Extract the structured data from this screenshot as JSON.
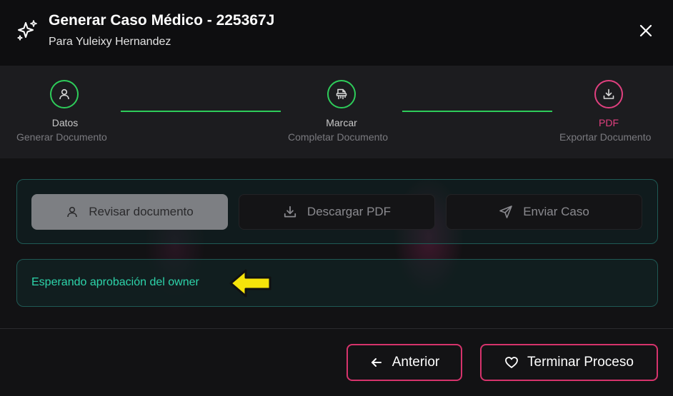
{
  "header": {
    "title": "Generar Caso Médico - 225367J",
    "subtitle": "Para Yuleixy Hernandez"
  },
  "stepper": {
    "steps": [
      {
        "label": "Datos",
        "sublabel": "Generar Documento",
        "icon": "user-icon",
        "state": "completed"
      },
      {
        "label": "Marcar",
        "sublabel": "Completar Documento",
        "icon": "shredder-icon",
        "state": "completed"
      },
      {
        "label": "PDF",
        "sublabel": "Exportar Documento",
        "icon": "download-icon",
        "state": "current"
      }
    ]
  },
  "actions": {
    "review_label": "Revisar documento",
    "download_label": "Descargar PDF",
    "send_label": "Enviar Caso"
  },
  "status": {
    "message": "Esperando aprobación del owner"
  },
  "footer": {
    "previous_label": "Anterior",
    "finish_label": "Terminar Proceso"
  },
  "colors": {
    "success": "#2ecc5a",
    "accent": "#e0407f",
    "status_text": "#2dd4aa",
    "panel_border": "#1f5a55",
    "annotation_arrow": "#f5e30a"
  }
}
